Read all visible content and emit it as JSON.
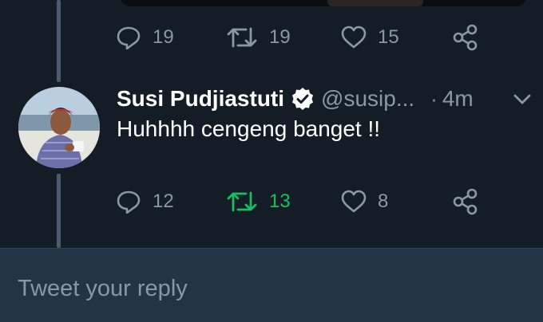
{
  "previous_tweet": {
    "actions": {
      "reply_count": "19",
      "retweet_count": "19",
      "like_count": "15"
    }
  },
  "tweet": {
    "author_name": "Susi Pudjiastuti",
    "handle": "@susip...",
    "separator": "·",
    "time": "4m",
    "text": "Huhhhh cengeng banget !!",
    "actions": {
      "reply_count": "12",
      "retweet_count": "13",
      "like_count": "8"
    }
  },
  "reply": {
    "placeholder": "Tweet your reply"
  },
  "colors": {
    "background": "#141d26",
    "reply_bar": "#243447",
    "muted": "#8899a6",
    "retweet_active": "#17bf63",
    "thread_line": "#4b5c6e"
  },
  "icons": [
    "reply-icon",
    "retweet-icon",
    "like-icon",
    "share-icon",
    "verified-badge-icon",
    "chevron-down-icon"
  ]
}
